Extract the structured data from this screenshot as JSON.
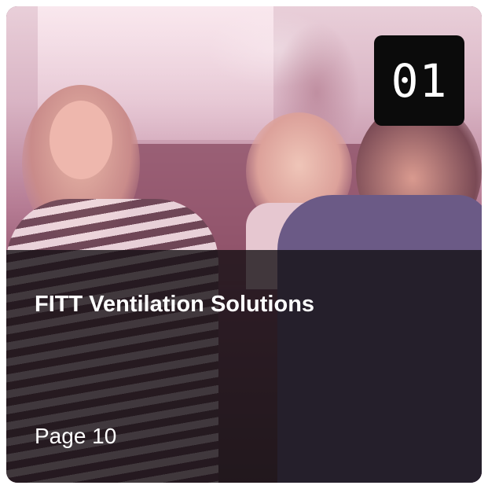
{
  "card": {
    "badge_number": "01",
    "title": "FITT Ventilation Solutions",
    "page_reference": "Page 10"
  },
  "image": {
    "semantic": "family-photo"
  },
  "colors": {
    "badge_background": "#0b0b0b",
    "overlay_tint": "#8a4e67",
    "text": "#ffffff"
  }
}
